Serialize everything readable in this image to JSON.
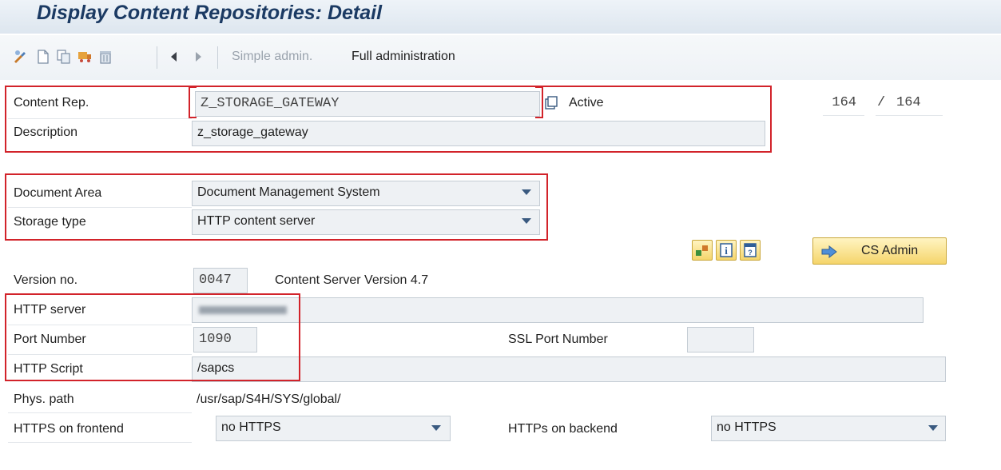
{
  "title": "Display Content Repositories: Detail",
  "toolbar": {
    "simple_admin": "Simple admin.",
    "full_admin": "Full administration"
  },
  "header": {
    "counter_current": "164",
    "counter_sep": "/",
    "counter_total": "164"
  },
  "form": {
    "content_rep_label": "Content Rep.",
    "content_rep_value": "Z_STORAGE_GATEWAY",
    "status": "Active",
    "description_label": "Description",
    "description_value": "z_storage_gateway",
    "doc_area_label": "Document Area",
    "doc_area_value": "Document Management System",
    "storage_type_label": "Storage type",
    "storage_type_value": "HTTP content server",
    "cs_admin_label": "CS Admin",
    "version_label": "Version no.",
    "version_value": "0047",
    "version_text": "Content Server Version 4.7",
    "http_server_label": "HTTP server",
    "port_label": "Port Number",
    "port_value": "1090",
    "ssl_port_label": "SSL Port Number",
    "ssl_port_value": "",
    "http_script_label": "HTTP Script",
    "http_script_value": "/sapcs",
    "phys_path_label": "Phys. path",
    "phys_path_value": "/usr/sap/S4H/SYS/global/",
    "https_frontend_label": "HTTPS on frontend",
    "https_frontend_value": "no HTTPS",
    "https_backend_label": "HTTPs on backend",
    "https_backend_value": "no HTTPS"
  },
  "colors": {
    "highlight": "#d2232a",
    "title": "#1b3a63",
    "button": "#f5d56b"
  }
}
